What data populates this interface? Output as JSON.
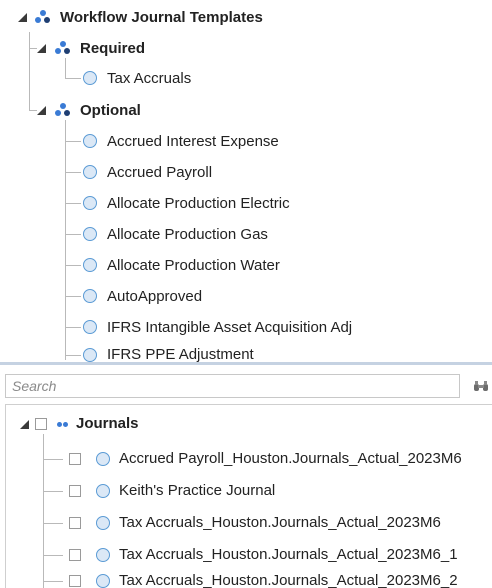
{
  "top_tree": {
    "root": {
      "label": "Workflow Journal Templates"
    },
    "groups": [
      {
        "label": "Required",
        "items": [
          "Tax Accruals"
        ]
      },
      {
        "label": "Optional",
        "items": [
          "Accrued Interest Expense",
          "Accrued Payroll",
          "Allocate Production Electric",
          "Allocate Production Gas",
          "Allocate Production Water",
          "AutoApproved",
          "IFRS Intangible Asset Acquisition Adj",
          "IFRS PPE Adjustment"
        ]
      }
    ]
  },
  "search": {
    "placeholder": "Search"
  },
  "bottom_tree": {
    "root": {
      "label": "Journals"
    },
    "items": [
      "Accrued Payroll_Houston.Journals_Actual_2023M6",
      "Keith's Practice Journal",
      "Tax Accruals_Houston.Journals_Actual_2023M6",
      "Tax Accruals_Houston.Journals_Actual_2023M6_1",
      "Tax Accruals_Houston.Journals_Actual_2023M6_2"
    ]
  },
  "colors": {
    "accent_blue": "#3a7bd5",
    "circle_fill": "#dbe8f6",
    "circle_border": "#5b9bd5",
    "splitter": "#c5d2e2",
    "tree_line": "#b9b9b9"
  },
  "icons": {
    "expand": "triangle-down-icon",
    "group": "group-dots-icon",
    "item": "circle-node-icon",
    "find": "binoculars-icon"
  }
}
